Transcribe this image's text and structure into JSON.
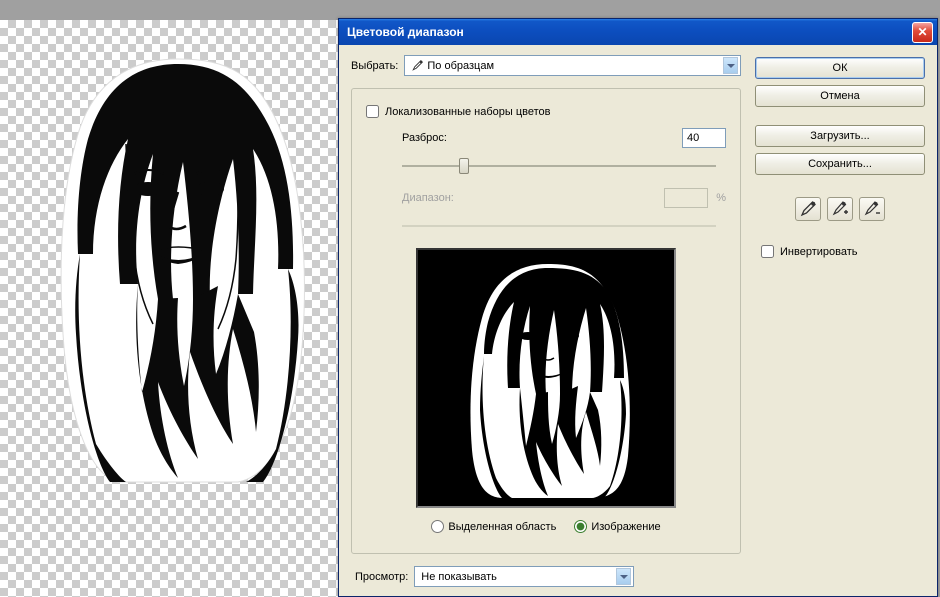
{
  "dialog": {
    "title": "Цветовой диапазон",
    "select_label": "Выбрать:",
    "select_value": "По образцам",
    "localized_label": "Локализованные наборы цветов",
    "fuzziness_label": "Разброс:",
    "fuzziness_value": "40",
    "range_label": "Диапазон:",
    "range_unit": "%",
    "radio_selection": "Выделенная область",
    "radio_image": "Изображение",
    "preview_label": "Просмотр:",
    "preview_value": "Не показывать"
  },
  "buttons": {
    "ok": "ОК",
    "cancel": "Отмена",
    "load": "Загрузить...",
    "save": "Сохранить...",
    "invert": "Инвертировать"
  },
  "icons": {
    "close": "✕",
    "eyedropper": "eyedropper",
    "eyedropper_plus": "eyedropper-plus",
    "eyedropper_minus": "eyedropper-minus"
  }
}
